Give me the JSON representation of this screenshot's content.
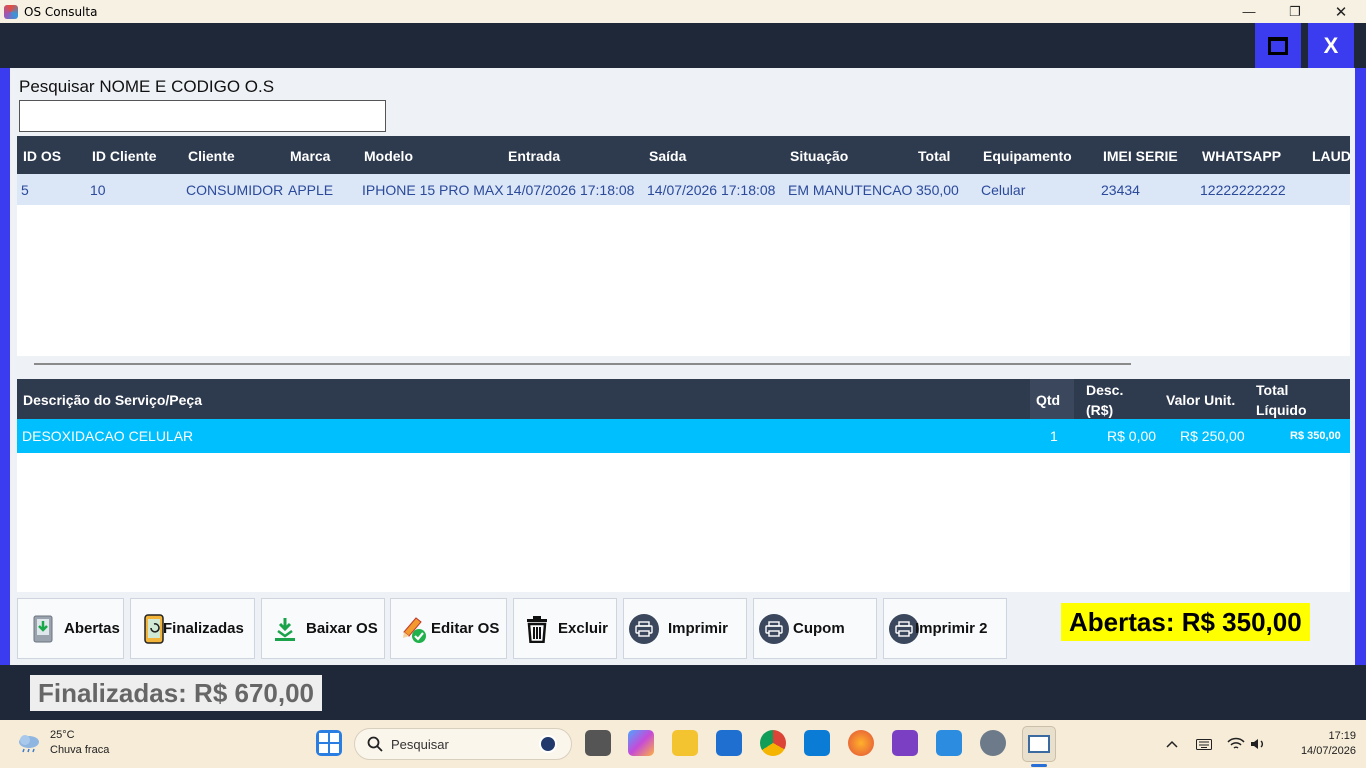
{
  "window": {
    "title": "OS Consulta",
    "minimize": "—",
    "maximize": "❐",
    "close": "✕"
  },
  "header": {
    "close_label": "X"
  },
  "search": {
    "label": "Pesquisar NOME E CODIGO O.S",
    "value": ""
  },
  "os_grid": {
    "columns": [
      "ID OS",
      "ID Cliente",
      "Cliente",
      "Marca",
      "Modelo",
      "Entrada",
      "Saída",
      "Situação",
      "Total",
      "Equipamento",
      "IMEI SERIE",
      "WHATSAPP",
      "LAUDO"
    ],
    "rows": [
      [
        "5",
        "10",
        "CONSUMIDOR",
        "APPLE",
        "IPHONE 15 PRO MAX",
        "14/07/2026 17:18:08",
        "14/07/2026 17:18:08",
        "EM MANUTENCAO",
        "350,00",
        "Celular",
        "23434",
        "12222222222",
        ""
      ]
    ]
  },
  "items_grid": {
    "columns": {
      "descricao": "Descrição do Serviço/Peça",
      "qtd": "Qtd",
      "desc_1": "Desc.",
      "desc_2": "(R$)",
      "valor_unit": "Valor Unit.",
      "total_1": "Total",
      "total_2": "Líquido"
    },
    "rows": [
      {
        "descricao": "DESOXIDACAO CELULAR",
        "qtd": "1",
        "desc": "R$ 0,00",
        "valor_unit": "R$ 250,00",
        "total": "R$ 350,00"
      }
    ]
  },
  "buttons": {
    "abertas": "Abertas",
    "finalizadas": "Finalizadas",
    "baixar": "Baixar OS",
    "editar": "Editar OS",
    "excluir": "Excluir",
    "imprimir": "Imprimir",
    "cupom": "Cupom",
    "imprimir2": "Imprimir 2"
  },
  "totals": {
    "abertas": "Abertas: R$ 350,00",
    "finalizadas": "Finalizadas: R$ 670,00"
  },
  "taskbar": {
    "weather_temp": "25°C",
    "weather_desc": "Chuva fraca",
    "search_placeholder": "Pesquisar",
    "time": "17:19",
    "date": "14/07/2026"
  },
  "colors": {
    "accent_blue": "#3b3bf0",
    "dark": "#1f2838",
    "selected_row": "#00bfff",
    "highlight": "#ffff00"
  }
}
